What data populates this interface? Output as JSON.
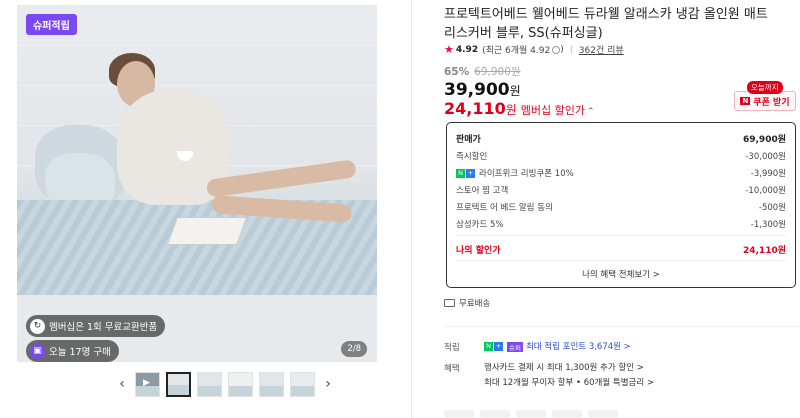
{
  "gallery": {
    "badge": "슈퍼적립",
    "pill_membership": "멤버십은 1회 무료교환반품",
    "pill_today": "오늘 17명 구매",
    "counter": "2/8",
    "thumbnail_count": 6,
    "active_thumbnail": 2
  },
  "product": {
    "title": "프로텍트어베드 웰어베드 듀라웰 알래스카 냉감 올인원 매트리스커버 블루, SS(슈퍼싱글)",
    "rating": {
      "score": "4.92",
      "recent": "(최근 6개월 4.92",
      "reviews": "362건 리뷰"
    },
    "discount_rate": "65%",
    "original_price": "69,900원",
    "sale_price": "39,900",
    "sale_won": "원",
    "member_price": "24,110",
    "member_won": "원",
    "member_label": "멤버십 할인가"
  },
  "coupon": {
    "today": "오늘까지",
    "button": "쿠폰 받기",
    "n_mark": "N"
  },
  "price_box": {
    "rows": [
      {
        "label": "판매가",
        "value": "69,900원"
      },
      {
        "label": "즉시할인",
        "value": "-30,000원"
      },
      {
        "label": "라이프위크 리빙쿠폰 10%",
        "value": "-3,990원"
      },
      {
        "label": "스토어 찜 고객",
        "value": "-10,000원"
      },
      {
        "label": "프로텍트 어 베드 알림 동의",
        "value": "-500원"
      },
      {
        "label": "삼성카드 5%",
        "value": "-1,300원"
      },
      {
        "label": "나의 할인가",
        "value": "24,110원"
      }
    ],
    "view_all": "나의 혜택 전체보기 >"
  },
  "shipping": "무료배송",
  "benefits": {
    "earn_label": "적립",
    "earn_super": "슈퍼",
    "earn_value": "최대 적립 포인트 3,674원 >",
    "benefit_label": "혜택",
    "benefit_line1": "행사카드 결제 시 최대 1,300원 추가 할인 >",
    "benefit_line2": "최대 12개월 무이자 할부 • 60개월 특별금리 >"
  },
  "colors": {
    "accent_red": "#e0001b",
    "super_purple": "#7a4af0",
    "naver_green": "#03c75a"
  }
}
